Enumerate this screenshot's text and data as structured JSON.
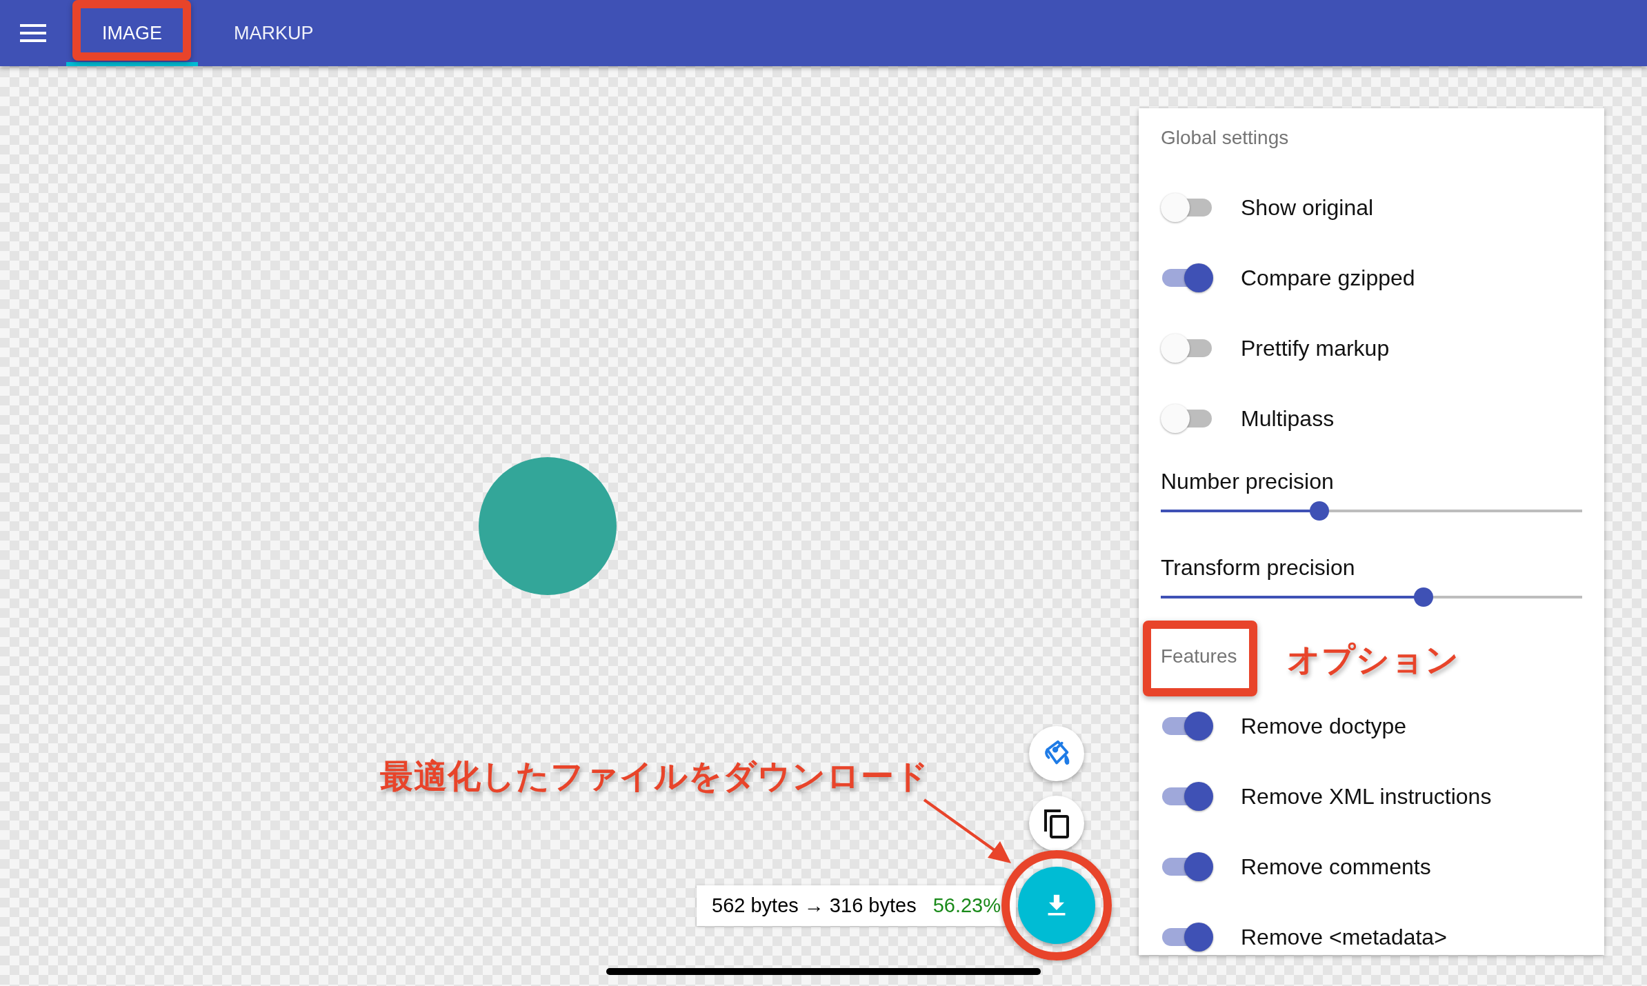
{
  "header": {
    "tabs": [
      {
        "label": "IMAGE",
        "selected": true
      },
      {
        "label": "MARKUP",
        "selected": false
      }
    ]
  },
  "settings": {
    "title": "Global settings",
    "items": [
      {
        "kind": "toggle",
        "label": "Show original",
        "on": false
      },
      {
        "kind": "toggle",
        "label": "Compare gzipped",
        "on": true
      },
      {
        "kind": "toggle",
        "label": "Prettify markup",
        "on": false
      },
      {
        "kind": "toggle",
        "label": "Multipass",
        "on": false
      },
      {
        "kind": "slider",
        "label": "Number precision",
        "level": 0.37
      },
      {
        "kind": "slider",
        "label": "Transform precision",
        "level": 0.63
      }
    ]
  },
  "features": {
    "title": "Features",
    "items": [
      {
        "kind": "toggle",
        "label": "Remove doctype",
        "on": true
      },
      {
        "kind": "toggle",
        "label": "Remove XML instructions",
        "on": true
      },
      {
        "kind": "toggle",
        "label": "Remove comments",
        "on": true
      },
      {
        "kind": "toggle",
        "label": "Remove <metadata>",
        "on": true
      }
    ]
  },
  "stats": {
    "sizes": "562 bytes → 316 bytes",
    "saving": "56.23%"
  },
  "annotations": {
    "features_note": "オプション",
    "download_note": "最適化したファイルをダウンロード"
  }
}
